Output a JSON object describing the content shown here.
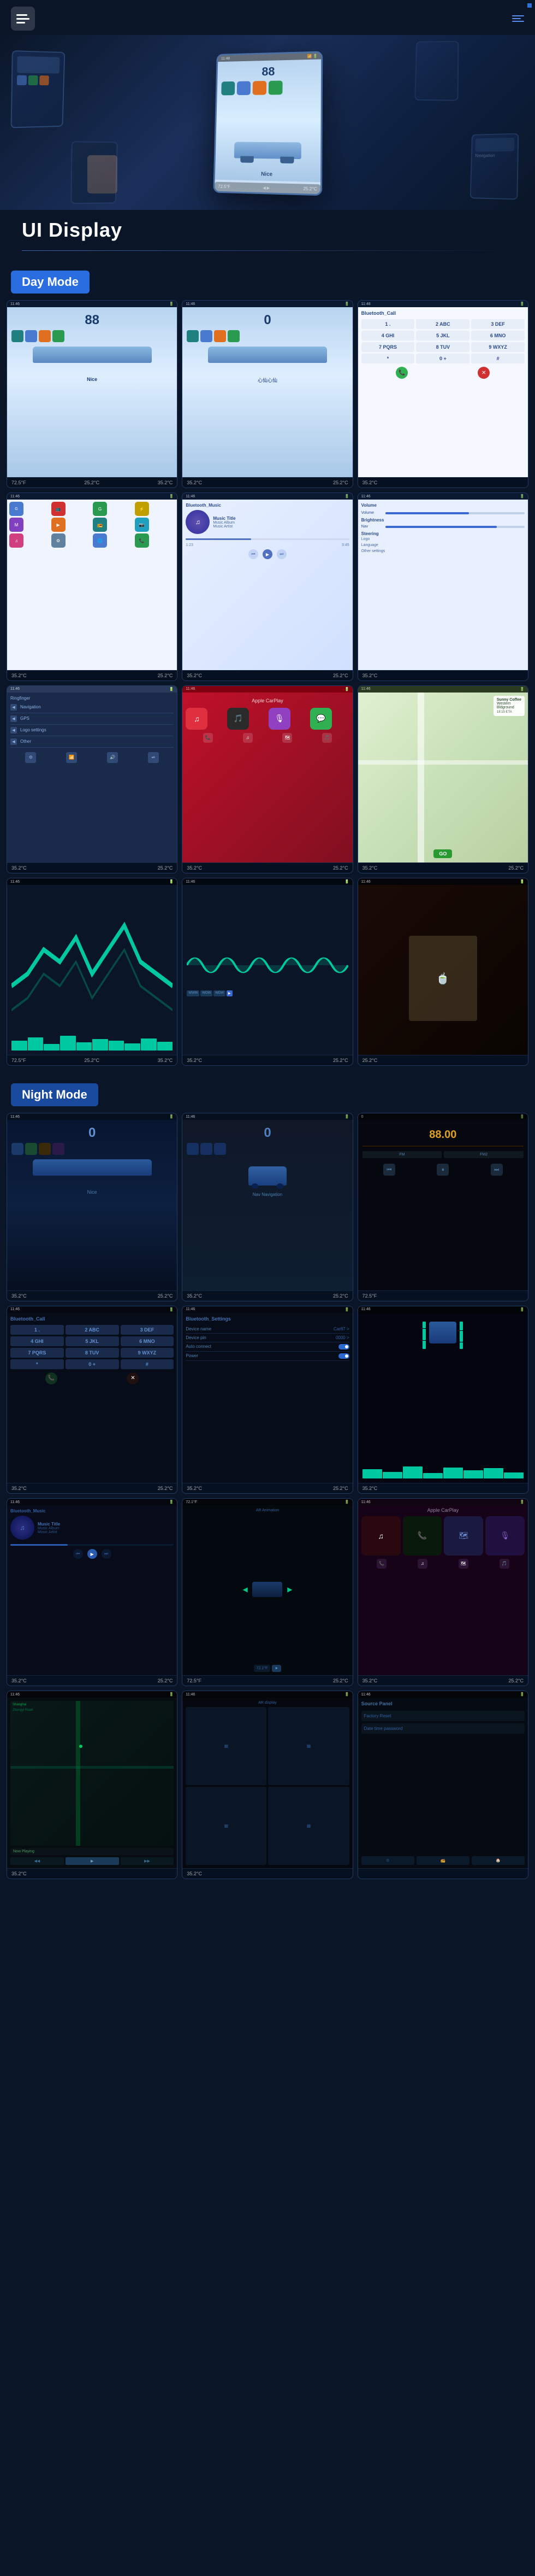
{
  "header": {
    "menu_icon": "menu-icon",
    "nav_icon": "nav-lines-icon",
    "title": "UI Display",
    "divider": true
  },
  "hero": {
    "device_number": "88",
    "car_label": "Nice",
    "temperature_left": "72.5°F",
    "temperature_right1": "25.2°C",
    "temperature_right2": "35.2°C"
  },
  "day_mode": {
    "label": "Day Mode",
    "screens": [
      {
        "id": "day-home-1",
        "type": "home",
        "number": "88",
        "label": "Nice",
        "bottom_temps": [
          "72.5°F",
          "25.2°C",
          "35.2°C"
        ]
      },
      {
        "id": "day-home-2",
        "type": "home2",
        "number": "0",
        "bottom_temps": [
          "35.2°C",
          "25.2°C"
        ]
      },
      {
        "id": "day-call",
        "type": "bluetooth_call",
        "title": "Bluetooth_Call",
        "bottom_temps": [
          "35.2°C"
        ]
      },
      {
        "id": "day-apps",
        "type": "app_grid",
        "bottom_temps": [
          "35.2°C",
          "25.2°C"
        ]
      },
      {
        "id": "day-music",
        "type": "music",
        "title": "Bluetooth_Music",
        "track": "Music Title",
        "artist": "Music Album",
        "album": "Music Artist",
        "bottom_temps": [
          "35.2°C",
          "25.2°C"
        ]
      },
      {
        "id": "day-settings",
        "type": "settings",
        "bottom_temps": [
          "35.2°C"
        ]
      },
      {
        "id": "day-nav",
        "type": "navigation",
        "bottom_temps": [
          "35.2°C",
          "25.2°C"
        ]
      },
      {
        "id": "day-carplay",
        "type": "carplay",
        "bottom_temps": [
          "35.2°C",
          "25.2°C"
        ]
      },
      {
        "id": "day-map",
        "type": "map",
        "location": "Sunny Coffee\nWestern\nBldground",
        "time": "18:15 ETA",
        "bottom_temps": [
          "35.2°C",
          "25.2°C"
        ]
      },
      {
        "id": "day-eq1",
        "type": "equalizer",
        "bottom_temps": [
          "72.5°F",
          "25.2°C",
          "35.2°C"
        ]
      },
      {
        "id": "day-eq2",
        "type": "waveform",
        "bottom_temps": [
          "35.2°C",
          "25.2°C"
        ]
      },
      {
        "id": "day-video",
        "type": "video",
        "bottom_temps": [
          "25.2°C"
        ]
      }
    ]
  },
  "night_mode": {
    "label": "Night Mode",
    "screens": [
      {
        "id": "night-home-1",
        "type": "night_home",
        "number": "0",
        "bottom_temps": [
          "35.2°C",
          "25.2°C"
        ]
      },
      {
        "id": "night-home-2",
        "type": "night_home2",
        "number": "0",
        "bottom_temps": [
          "35.2°C",
          "25.2°C"
        ]
      },
      {
        "id": "night-radio",
        "type": "night_radio",
        "freq": "88.00",
        "bottom_temps": [
          "72.5°F"
        ]
      },
      {
        "id": "night-bt-call",
        "type": "night_bt_call",
        "title": "Bluetooth_Call",
        "bottom_temps": [
          "35.2°C",
          "25.2°C"
        ]
      },
      {
        "id": "night-bt-settings",
        "type": "night_bt_settings",
        "title": "Bluetooth_Settings",
        "device_name": "Car87",
        "device_pin": "0000",
        "auto_connect": "Auto connect",
        "power": "Power",
        "bottom_temps": [
          "35.2°C",
          "25.2°C"
        ]
      },
      {
        "id": "night-eq",
        "type": "night_equalizer",
        "bottom_temps": [
          "35.2°C"
        ]
      },
      {
        "id": "night-bt-music",
        "type": "night_bt_music",
        "title": "Bluetooth_Music",
        "track": "Music Title",
        "artist": "Music Album",
        "album": "Music Artist",
        "bottom_temps": [
          "35.2°C",
          "25.2°C"
        ]
      },
      {
        "id": "night-ar",
        "type": "night_ar",
        "bottom_temps": [
          "72.5°F",
          "25.2°C"
        ]
      },
      {
        "id": "night-carplay",
        "type": "night_carplay",
        "bottom_temps": [
          "35.2°C",
          "25.2°C"
        ]
      },
      {
        "id": "night-drive",
        "type": "night_drive",
        "location": "Shanghai",
        "route": "Zhongyi Road",
        "bottom_temps": [
          "35.2°C"
        ]
      },
      {
        "id": "night-ar2",
        "type": "night_ar2",
        "bottom_temps": [
          "35.2°C"
        ]
      },
      {
        "id": "night-panel",
        "type": "night_panel",
        "title": "Source Panel",
        "items": [
          "Factory Reset",
          "Date time password"
        ],
        "bottom_temps": []
      }
    ]
  },
  "icons": {
    "menu": "☰",
    "nav": "≡",
    "phone": "📞",
    "music": "♫",
    "settings": "⚙",
    "maps": "🗺",
    "back": "◀",
    "forward": "▶",
    "play": "▶",
    "pause": "⏸",
    "prev": "⏮",
    "next": "⏭",
    "home": "⌂",
    "search": "🔍",
    "bluetooth": "⚡",
    "wifi": "📶",
    "car": "🚗"
  },
  "colors": {
    "bg_primary": "#0a1628",
    "bg_secondary": "#0d1f3c",
    "accent_blue": "#2a6de0",
    "accent_teal": "#00c8a0",
    "day_badge": "#2a6de0",
    "night_badge": "#1a4a9e",
    "text_primary": "#ffffff",
    "text_secondary": "rgba(255,255,255,0.7)",
    "divider": "rgba(100,150,255,0.4)"
  }
}
